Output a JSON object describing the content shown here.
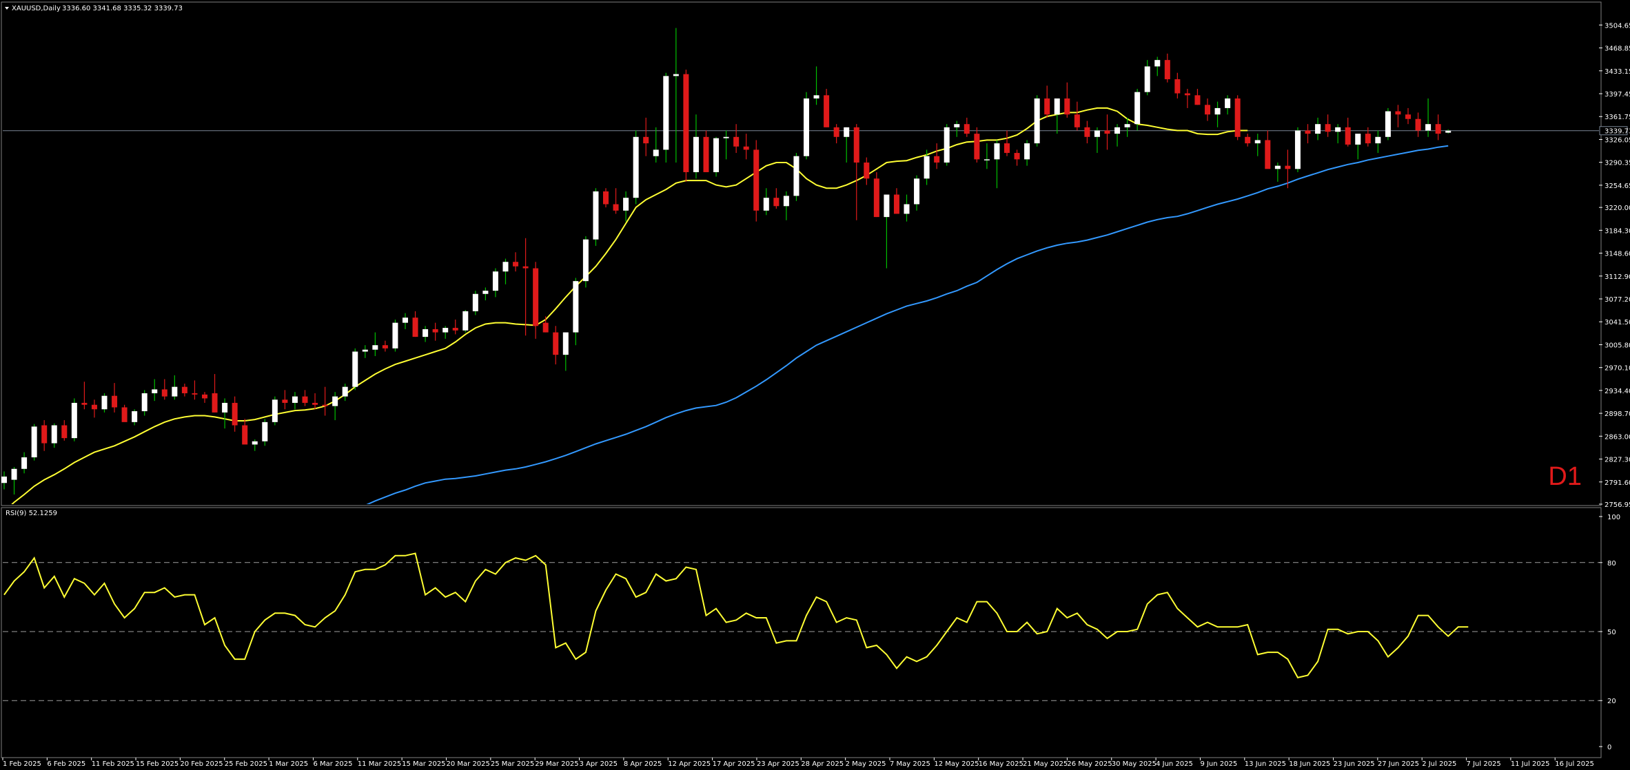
{
  "window": {
    "symbol_title": "XAUUSD,Daily",
    "ohlc": "3336.60 3341.68 3335.32 3339.73",
    "timeframe_badge": "D1",
    "current_price_label": "3339.73"
  },
  "colors": {
    "bull_candle": "#ffffff",
    "bear_candle": "#e01a1a",
    "bull_wick": "#00c000",
    "bear_wick": "#e01a1a",
    "ma_fast": "#ffff33",
    "ma_slow": "#3399ff",
    "rsi_line": "#ffff33",
    "grid_dash": "#a0a0a0",
    "price_line": "#7a8696",
    "frame": "#808080"
  },
  "chart_data": [
    {
      "type": "candlestick",
      "name_panel": "price",
      "y_ticks": [
        "3504.65",
        "3468.85",
        "3433.15",
        "3397.45",
        "3361.75",
        "3326.05",
        "3290.35",
        "3254.65",
        "3220.00",
        "3184.30",
        "3148.60",
        "3112.90",
        "3077.20",
        "3041.50",
        "3005.80",
        "2970.10",
        "2934.40",
        "2898.70",
        "2863.00",
        "2827.30",
        "2791.60",
        "2756.95"
      ],
      "ylim": [
        2756.95,
        3520
      ],
      "x_tick_labels": [
        "1 Feb 2025",
        "6 Feb 2025",
        "11 Feb 2025",
        "15 Feb 2025",
        "20 Feb 2025",
        "25 Feb 2025",
        "1 Mar 2025",
        "6 Mar 2025",
        "11 Mar 2025",
        "15 Mar 2025",
        "20 Mar 2025",
        "25 Mar 2025",
        "29 Mar 2025",
        "3 Apr 2025",
        "8 Apr 2025",
        "12 Apr 2025",
        "17 Apr 2025",
        "23 Apr 2025",
        "28 Apr 2025",
        "2 May 2025",
        "7 May 2025",
        "12 May 2025",
        "16 May 2025",
        "21 May 2025",
        "26 May 2025",
        "30 May 2025",
        "4 Jun 2025",
        "9 Jun 2025",
        "13 Jun 2025",
        "18 Jun 2025",
        "23 Jun 2025",
        "27 Jun 2025",
        "2 Jul 2025",
        "7 Jul 2025",
        "11 Jul 2025",
        "16 Jul 2025"
      ],
      "candles": [
        [
          2790,
          2808,
          2780,
          2800
        ],
        [
          2795,
          2815,
          2772,
          2812
        ],
        [
          2812,
          2838,
          2805,
          2830
        ],
        [
          2830,
          2882,
          2825,
          2878
        ],
        [
          2880,
          2888,
          2840,
          2852
        ],
        [
          2852,
          2883,
          2845,
          2880
        ],
        [
          2880,
          2888,
          2856,
          2860
        ],
        [
          2860,
          2922,
          2855,
          2915
        ],
        [
          2915,
          2948,
          2905,
          2912
        ],
        [
          2912,
          2920,
          2892,
          2905
        ],
        [
          2905,
          2930,
          2900,
          2926
        ],
        [
          2926,
          2946,
          2900,
          2908
        ],
        [
          2908,
          2912,
          2890,
          2885
        ],
        [
          2885,
          2905,
          2880,
          2902
        ],
        [
          2902,
          2935,
          2895,
          2930
        ],
        [
          2930,
          2952,
          2918,
          2936
        ],
        [
          2936,
          2952,
          2920,
          2925
        ],
        [
          2925,
          2958,
          2920,
          2940
        ],
        [
          2940,
          2945,
          2925,
          2930
        ],
        [
          2930,
          2950,
          2920,
          2928
        ],
        [
          2928,
          2932,
          2915,
          2922
        ],
        [
          2930,
          2960,
          2900,
          2900
        ],
        [
          2900,
          2922,
          2875,
          2915
        ],
        [
          2915,
          2925,
          2870,
          2880
        ],
        [
          2880,
          2890,
          2855,
          2850
        ],
        [
          2850,
          2858,
          2840,
          2855
        ],
        [
          2855,
          2890,
          2848,
          2885
        ],
        [
          2885,
          2925,
          2880,
          2920
        ],
        [
          2920,
          2935,
          2905,
          2915
        ],
        [
          2915,
          2932,
          2905,
          2925
        ],
        [
          2925,
          2935,
          2910,
          2915
        ],
        [
          2915,
          2930,
          2905,
          2912
        ],
        [
          2912,
          2940,
          2895,
          2910
        ],
        [
          2910,
          2932,
          2888,
          2925
        ],
        [
          2925,
          2945,
          2918,
          2940
        ],
        [
          2940,
          3000,
          2935,
          2995
        ],
        [
          2995,
          3005,
          2985,
          2998
        ],
        [
          2998,
          3025,
          2988,
          3005
        ],
        [
          3005,
          3012,
          2995,
          3000
        ],
        [
          3000,
          3045,
          2995,
          3040
        ],
        [
          3040,
          3055,
          3030,
          3048
        ],
        [
          3048,
          3058,
          3018,
          3018
        ],
        [
          3018,
          3035,
          3010,
          3030
        ],
        [
          3030,
          3040,
          3012,
          3025
        ],
        [
          3025,
          3035,
          3015,
          3032
        ],
        [
          3032,
          3045,
          3022,
          3028
        ],
        [
          3028,
          3060,
          3025,
          3058
        ],
        [
          3058,
          3090,
          3052,
          3085
        ],
        [
          3085,
          3095,
          3075,
          3090
        ],
        [
          3090,
          3125,
          3080,
          3120
        ],
        [
          3120,
          3140,
          3100,
          3135
        ],
        [
          3135,
          3150,
          3120,
          3128
        ],
        [
          3128,
          3172,
          3020,
          3125
        ],
        [
          3125,
          3135,
          3015,
          3035
        ],
        [
          3040,
          3050,
          3025,
          3025
        ],
        [
          3025,
          3035,
          2975,
          2990
        ],
        [
          2990,
          3010,
          2965,
          3025
        ],
        [
          3025,
          3110,
          3005,
          3105
        ],
        [
          3105,
          3175,
          3095,
          3170
        ],
        [
          3170,
          3250,
          3160,
          3245
        ],
        [
          3245,
          3250,
          3220,
          3225
        ],
        [
          3225,
          3250,
          3210,
          3215
        ],
        [
          3215,
          3245,
          3198,
          3235
        ],
        [
          3235,
          3340,
          3225,
          3330
        ],
        [
          3330,
          3360,
          3300,
          3320
        ],
        [
          3300,
          3345,
          3290,
          3310
        ],
        [
          3310,
          3430,
          3290,
          3425
        ],
        [
          3425,
          3500,
          3290,
          3428
        ],
        [
          3428,
          3435,
          3260,
          3275
        ],
        [
          3275,
          3365,
          3265,
          3330
        ],
        [
          3330,
          3340,
          3275,
          3275
        ],
        [
          3275,
          3330,
          3268,
          3328
        ],
        [
          3328,
          3340,
          3295,
          3330
        ],
        [
          3330,
          3350,
          3305,
          3315
        ],
        [
          3315,
          3335,
          3295,
          3310
        ],
        [
          3310,
          3325,
          3198,
          3215
        ],
        [
          3215,
          3250,
          3208,
          3235
        ],
        [
          3235,
          3250,
          3218,
          3222
        ],
        [
          3222,
          3245,
          3200,
          3238
        ],
        [
          3238,
          3305,
          3230,
          3300
        ],
        [
          3300,
          3400,
          3295,
          3390
        ],
        [
          3390,
          3440,
          3380,
          3395
        ],
        [
          3395,
          3405,
          3345,
          3345
        ],
        [
          3345,
          3350,
          3320,
          3330
        ],
        [
          3330,
          3345,
          3290,
          3345
        ],
        [
          3345,
          3350,
          3200,
          3290
        ],
        [
          3290,
          3298,
          3255,
          3265
        ],
        [
          3265,
          3275,
          3205,
          3205
        ],
        [
          3205,
          3240,
          3125,
          3240
        ],
        [
          3240,
          3250,
          3210,
          3210
        ],
        [
          3210,
          3240,
          3198,
          3225
        ],
        [
          3225,
          3270,
          3215,
          3265
        ],
        [
          3265,
          3310,
          3255,
          3300
        ],
        [
          3300,
          3320,
          3280,
          3290
        ],
        [
          3290,
          3350,
          3285,
          3345
        ],
        [
          3345,
          3355,
          3330,
          3350
        ],
        [
          3350,
          3360,
          3330,
          3335
        ],
        [
          3335,
          3345,
          3290,
          3295
        ],
        [
          3295,
          3320,
          3280,
          3295
        ],
        [
          3295,
          3325,
          3250,
          3320
        ],
        [
          3320,
          3340,
          3300,
          3305
        ],
        [
          3305,
          3310,
          3285,
          3295
        ],
        [
          3295,
          3325,
          3285,
          3320
        ],
        [
          3320,
          3395,
          3315,
          3390
        ],
        [
          3390,
          3410,
          3360,
          3365
        ],
        [
          3365,
          3390,
          3335,
          3390
        ],
        [
          3390,
          3415,
          3360,
          3365
        ],
        [
          3365,
          3385,
          3340,
          3345
        ],
        [
          3345,
          3355,
          3320,
          3330
        ],
        [
          3330,
          3345,
          3305,
          3340
        ],
        [
          3340,
          3365,
          3310,
          3335
        ],
        [
          3335,
          3350,
          3315,
          3345
        ],
        [
          3345,
          3360,
          3330,
          3350
        ],
        [
          3350,
          3405,
          3340,
          3400
        ],
        [
          3400,
          3450,
          3395,
          3440
        ],
        [
          3440,
          3455,
          3425,
          3450
        ],
        [
          3450,
          3460,
          3415,
          3420
        ],
        [
          3420,
          3430,
          3390,
          3398
        ],
        [
          3398,
          3405,
          3375,
          3395
        ],
        [
          3395,
          3405,
          3380,
          3380
        ],
        [
          3380,
          3390,
          3355,
          3365
        ],
        [
          3365,
          3385,
          3345,
          3375
        ],
        [
          3375,
          3395,
          3365,
          3390
        ],
        [
          3390,
          3395,
          3325,
          3330
        ],
        [
          3330,
          3335,
          3315,
          3320
        ],
        [
          3320,
          3335,
          3300,
          3325
        ],
        [
          3325,
          3340,
          3295,
          3280
        ],
        [
          3280,
          3290,
          3260,
          3285
        ],
        [
          3285,
          3310,
          3250,
          3280
        ],
        [
          3280,
          3345,
          3275,
          3340
        ],
        [
          3340,
          3350,
          3320,
          3335
        ],
        [
          3335,
          3360,
          3325,
          3350
        ],
        [
          3350,
          3365,
          3330,
          3338
        ],
        [
          3338,
          3350,
          3320,
          3345
        ],
        [
          3345,
          3360,
          3315,
          3318
        ],
        [
          3318,
          3335,
          3295,
          3335
        ],
        [
          3335,
          3345,
          3315,
          3320
        ],
        [
          3320,
          3340,
          3305,
          3330
        ],
        [
          3330,
          3375,
          3325,
          3370
        ],
        [
          3370,
          3380,
          3345,
          3365
        ],
        [
          3365,
          3375,
          3350,
          3358
        ],
        [
          3358,
          3368,
          3330,
          3340
        ],
        [
          3340,
          3390,
          3330,
          3350
        ],
        [
          3350,
          3365,
          3325,
          3335
        ],
        [
          3336.6,
          3341.68,
          3335.32,
          3339.73
        ]
      ],
      "ma_fast": [
        2745,
        2760,
        2772,
        2785,
        2795,
        2803,
        2812,
        2822,
        2830,
        2838,
        2843,
        2848,
        2855,
        2862,
        2870,
        2878,
        2885,
        2890,
        2893,
        2895,
        2895,
        2893,
        2890,
        2887,
        2887,
        2889,
        2893,
        2897,
        2900,
        2903,
        2904,
        2906,
        2910,
        2918,
        2928,
        2940,
        2950,
        2960,
        2968,
        2975,
        2980,
        2985,
        2990,
        2995,
        3000,
        3010,
        3022,
        3032,
        3038,
        3040,
        3040,
        3038,
        3037,
        3036,
        3045,
        3062,
        3080,
        3097,
        3112,
        3128,
        3148,
        3170,
        3195,
        3220,
        3232,
        3240,
        3248,
        3258,
        3262,
        3262,
        3262,
        3255,
        3252,
        3255,
        3265,
        3275,
        3285,
        3290,
        3290,
        3280,
        3265,
        3255,
        3250,
        3250,
        3255,
        3262,
        3270,
        3280,
        3290,
        3292,
        3293,
        3298,
        3302,
        3308,
        3312,
        3318,
        3322,
        3323,
        3325,
        3325,
        3328,
        3333,
        3343,
        3355,
        3362,
        3365,
        3368,
        3368,
        3372,
        3375,
        3375,
        3370,
        3358,
        3350,
        3348,
        3345,
        3342,
        3340,
        3340,
        3335,
        3334,
        3334,
        3338,
        3340,
        3340
      ],
      "ma_slow": [
        2735,
        2742,
        2748,
        2755,
        2762,
        2768,
        2774,
        2779,
        2785,
        2790,
        2793,
        2796,
        2797,
        2799,
        2801,
        2804,
        2807,
        2810,
        2812,
        2815,
        2819,
        2823,
        2828,
        2833,
        2839,
        2845,
        2851,
        2856,
        2861,
        2866,
        2872,
        2878,
        2885,
        2892,
        2898,
        2903,
        2907,
        2909,
        2911,
        2916,
        2923,
        2932,
        2941,
        2951,
        2962,
        2973,
        2985,
        2995,
        3005,
        3012,
        3019,
        3026,
        3033,
        3040,
        3047,
        3054,
        3060,
        3066,
        3070,
        3074,
        3079,
        3085,
        3090,
        3097,
        3103,
        3113,
        3123,
        3132,
        3140,
        3146,
        3152,
        3157,
        3161,
        3164,
        3166,
        3169,
        3173,
        3177,
        3182,
        3187,
        3192,
        3197,
        3201,
        3204,
        3206,
        3210,
        3215,
        3220,
        3225,
        3229,
        3233,
        3238,
        3243,
        3249,
        3253,
        3258,
        3264,
        3269,
        3274,
        3279,
        3283,
        3287,
        3290,
        3294,
        3297,
        3300,
        3303,
        3306,
        3309,
        3311,
        3314,
        3316
      ]
    },
    {
      "type": "line",
      "name_panel": "rsi",
      "indicator_label": "RSI(9) 52.1259",
      "y_ticks": [
        "100",
        "80",
        "50",
        "20",
        "0"
      ],
      "ylim": [
        0,
        100
      ],
      "levels": [
        80,
        50,
        20
      ],
      "rsi_values": [
        66,
        72,
        76,
        82,
        69,
        74,
        65,
        73,
        71,
        66,
        71,
        62,
        56,
        60,
        67,
        67,
        69,
        65,
        66,
        66,
        53,
        56,
        44,
        38,
        38,
        50,
        55,
        58,
        58,
        57,
        53,
        52,
        56,
        59,
        66,
        76,
        77,
        77,
        79,
        83,
        83,
        84,
        66,
        69,
        65,
        67,
        63,
        72,
        77,
        75,
        80,
        82,
        81,
        83,
        79,
        43,
        45,
        38,
        41,
        59,
        68,
        75,
        73,
        65,
        67,
        75,
        72,
        73,
        78,
        77,
        57,
        60,
        54,
        55,
        58,
        56,
        56,
        45,
        46,
        46,
        57,
        65,
        63,
        54,
        56,
        55,
        43,
        44,
        40,
        34,
        39,
        37,
        39,
        44,
        50,
        56,
        54,
        63,
        63,
        58,
        50,
        50,
        54,
        49,
        50,
        60,
        56,
        58,
        53,
        51,
        47,
        50,
        50,
        51,
        62,
        66,
        67,
        60,
        56,
        52,
        54,
        52,
        52,
        52,
        53,
        40,
        41,
        41,
        38,
        30,
        31,
        37,
        51,
        51,
        49,
        50,
        50,
        46,
        39,
        43,
        48,
        57,
        57,
        52,
        48,
        52,
        52
      ]
    }
  ]
}
